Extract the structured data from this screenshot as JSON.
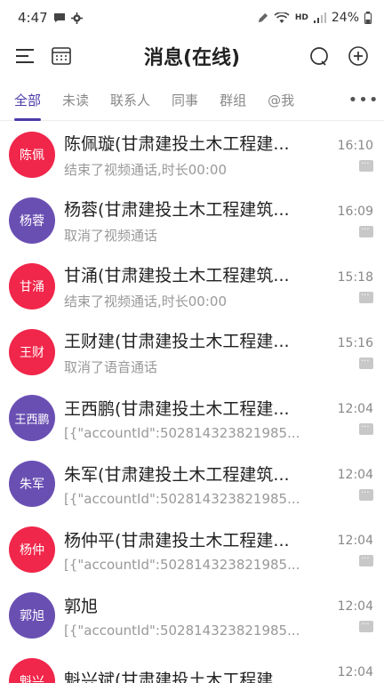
{
  "status_bar": {
    "time": "4:47",
    "battery": "24%",
    "hd": "HD"
  },
  "header": {
    "title": "消息(在线)"
  },
  "tabs": [
    {
      "label": "全部",
      "active": true
    },
    {
      "label": "未读",
      "active": false
    },
    {
      "label": "联系人",
      "active": false
    },
    {
      "label": "同事",
      "active": false
    },
    {
      "label": "群组",
      "active": false
    },
    {
      "label": "@我",
      "active": false
    }
  ],
  "conversations": [
    {
      "avatar_text": "陈佩",
      "avatar_color": "#f0264a",
      "name": "陈佩璇(甘肃建投土木工程建...",
      "preview": "结束了视频通话,时长00:00",
      "time": "16:10"
    },
    {
      "avatar_text": "杨蓉",
      "avatar_color": "#6a4fb3",
      "name": "杨蓉(甘肃建投土木工程建筑...",
      "preview": "取消了视频通话",
      "time": "16:09"
    },
    {
      "avatar_text": "甘涌",
      "avatar_color": "#f0264a",
      "name": "甘涌(甘肃建投土木工程建筑...",
      "preview": "结束了视频通话,时长00:00",
      "time": "15:18"
    },
    {
      "avatar_text": "王财",
      "avatar_color": "#f0264a",
      "name": "王财建(甘肃建投土木工程建...",
      "preview": "取消了语音通话",
      "time": "15:16"
    },
    {
      "avatar_text": "王西鹏",
      "avatar_color": "#6a4fb3",
      "name": "王西鹏(甘肃建投土木工程建...",
      "preview": "[{\"accountId\":502814323821985...",
      "time": "12:04"
    },
    {
      "avatar_text": "朱军",
      "avatar_color": "#6a4fb3",
      "name": "朱军(甘肃建投土木工程建筑...",
      "preview": "[{\"accountId\":502814323821985...",
      "time": "12:04"
    },
    {
      "avatar_text": "杨仲",
      "avatar_color": "#f0264a",
      "name": "杨仲平(甘肃建投土木工程建...",
      "preview": "[{\"accountId\":502814323821985...",
      "time": "12:04"
    },
    {
      "avatar_text": "郭旭",
      "avatar_color": "#6a4fb3",
      "name": "郭旭",
      "preview": "[{\"accountId\":502814323821985...",
      "time": "12:04"
    },
    {
      "avatar_text": "魁兴",
      "avatar_color": "#f0264a",
      "name": "魁兴斌(甘肃建投土木工程建...",
      "preview": "",
      "time": "12:04"
    }
  ],
  "icons": {
    "menu": "menu-icon",
    "calendar": "calendar-icon",
    "search": "search-icon",
    "add": "add-icon",
    "more": "more-icon"
  }
}
